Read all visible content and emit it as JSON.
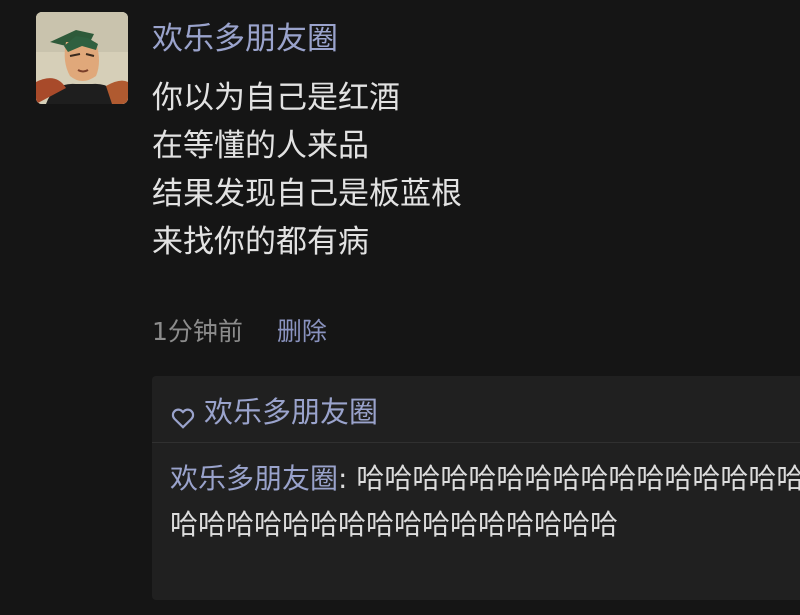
{
  "post": {
    "username": "欢乐多朋友圈",
    "lines": [
      "你以为自己是红酒",
      "在等懂的人来品",
      "结果发现自己是板蓝根",
      "来找你的都有病"
    ],
    "time": "1分钟前",
    "delete_label": "删除"
  },
  "interactions": {
    "like_icon": "heart-icon",
    "likes": "欢乐多朋友圈",
    "comment": {
      "author": "欢乐多朋友圈",
      "separator": ": ",
      "text": "哈哈哈哈哈哈哈哈哈哈哈哈哈哈哈哈哈哈哈哈哈哈哈哈哈哈哈哈哈哈哈哈"
    }
  },
  "colors": {
    "background": "#151515",
    "name": "#9aa3cc",
    "text": "#e2e2e2",
    "meta": "#8c8c8c",
    "panel": "#202020"
  }
}
